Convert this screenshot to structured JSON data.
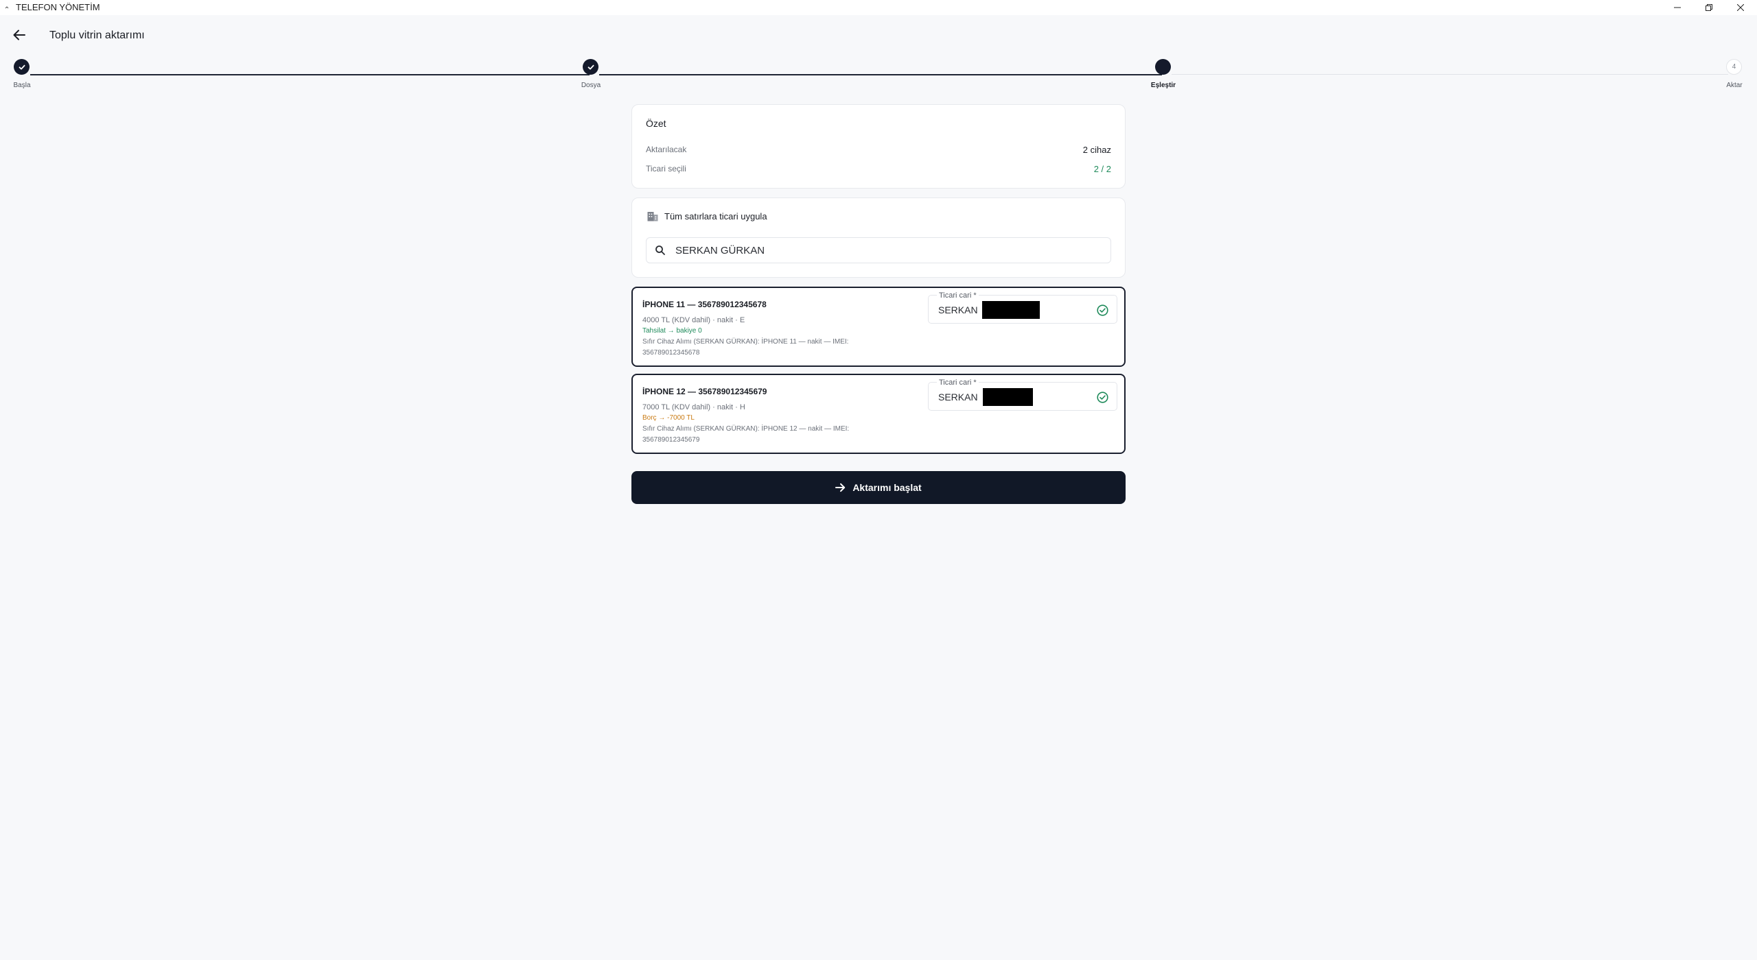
{
  "window": {
    "title": "TELEFON YÖNETİM"
  },
  "header": {
    "title": "Toplu vitrin aktarımı"
  },
  "stepper": {
    "steps": [
      {
        "label": "Başla",
        "state": "done"
      },
      {
        "label": "Dosya",
        "state": "done"
      },
      {
        "label": "Eşleştir",
        "state": "current"
      },
      {
        "label": "Aktar",
        "state": "todo",
        "number": "4"
      }
    ]
  },
  "summary": {
    "title": "Özet",
    "rows": [
      {
        "key": "Aktarılacak",
        "value": "2 cihaz"
      },
      {
        "key": "Ticari seçili",
        "value": "2 / 2"
      }
    ]
  },
  "apply_all": {
    "title": "Tüm satırlara ticari uygula",
    "search_value": "SERKAN GÜRKAN"
  },
  "devices": [
    {
      "title": "İPHONE 11 — 356789012345678",
      "price_line": "4000 TL (KDV dahil) · nakit · E",
      "status": "Tahsilat → bakiye 0",
      "desc_line1": "Sıfır Cihaz Alımı (SERKAN GÜRKAN): İPHONE 11 — nakit — IMEI:",
      "desc_line2": "356789012345678",
      "cari_label": "Ticari cari *",
      "cari_value": "SERKAN"
    },
    {
      "title": "İPHONE 12 — 356789012345679",
      "price_line": "7000 TL (KDV dahil) · nakit · H",
      "status": "Borç → -7000 TL",
      "desc_line1": "Sıfır Cihaz Alımı (SERKAN GÜRKAN): İPHONE 12 — nakit — IMEI:",
      "desc_line2": "356789012345679",
      "cari_label": "Ticari cari *",
      "cari_value": "SERKAN"
    }
  ],
  "actions": {
    "start_label": "Aktarımı başlat"
  },
  "colors": {
    "primary": "#111827",
    "success": "#1e8a5a",
    "warning": "#c97a12",
    "background": "#f7f8fa"
  }
}
